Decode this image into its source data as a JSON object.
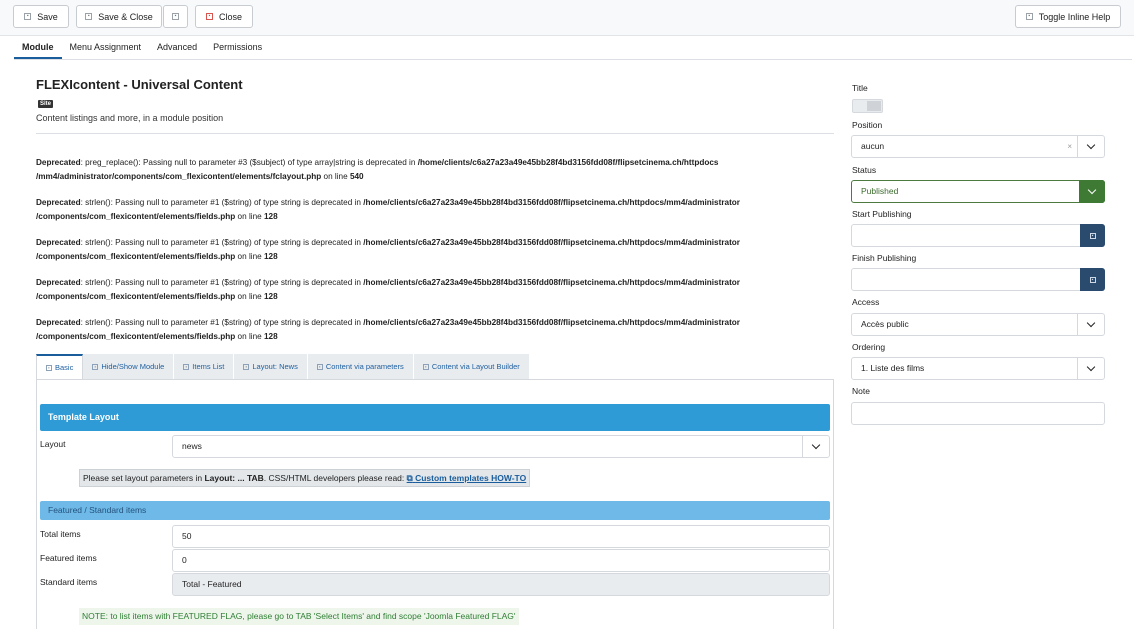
{
  "toolbar": {
    "save": "Save",
    "save_close": "Save & Close",
    "close": "Close",
    "toggle_help": "Toggle Inline Help"
  },
  "tabs": [
    "Module",
    "Menu Assignment",
    "Advanced",
    "Permissions"
  ],
  "module": {
    "title": "FLEXIcontent - Universal Content",
    "badge": "Site",
    "description": "Content listings and more, in a module position"
  },
  "deprecations": [
    {
      "label": "Deprecated",
      "message": ": preg_replace(): Passing null to parameter #3 ($subject) of type array|string is deprecated in ",
      "path1": "/home/clients/c6a27a23a49e45bb28f4bd3156fdd08f/flipsetcinema.ch/httpdocs",
      "path2": "/mm4/administrator/components/com_flexicontent/elements/fclayout.php",
      "online": " on line ",
      "line": "540"
    },
    {
      "label": "Deprecated",
      "message": ": strlen(): Passing null to parameter #1 ($string) of type string is deprecated in ",
      "path1": "/home/clients/c6a27a23a49e45bb28f4bd3156fdd08f/flipsetcinema.ch/httpdocs/mm4/administrator",
      "path2": "/components/com_flexicontent/elements/fields.php",
      "online": " on line ",
      "line": "128"
    },
    {
      "label": "Deprecated",
      "message": ": strlen(): Passing null to parameter #1 ($string) of type string is deprecated in ",
      "path1": "/home/clients/c6a27a23a49e45bb28f4bd3156fdd08f/flipsetcinema.ch/httpdocs/mm4/administrator",
      "path2": "/components/com_flexicontent/elements/fields.php",
      "online": " on line ",
      "line": "128"
    },
    {
      "label": "Deprecated",
      "message": ": strlen(): Passing null to parameter #1 ($string) of type string is deprecated in ",
      "path1": "/home/clients/c6a27a23a49e45bb28f4bd3156fdd08f/flipsetcinema.ch/httpdocs/mm4/administrator",
      "path2": "/components/com_flexicontent/elements/fields.php",
      "online": " on line ",
      "line": "128"
    },
    {
      "label": "Deprecated",
      "message": ": strlen(): Passing null to parameter #1 ($string) of type string is deprecated in ",
      "path1": "/home/clients/c6a27a23a49e45bb28f4bd3156fdd08f/flipsetcinema.ch/httpdocs/mm4/administrator",
      "path2": "/components/com_flexicontent/elements/fields.php",
      "online": " on line ",
      "line": "128"
    }
  ],
  "subtabs": [
    "Basic",
    "Hide/Show Module",
    "Items List",
    "Layout: News",
    "Content via parameters",
    "Content via Layout Builder"
  ],
  "template_layout": {
    "header": "Template Layout",
    "layout_label": "Layout",
    "layout_value": "news",
    "note_prefix": "Please set layout parameters in ",
    "note_bold": "Layout: ... TAB",
    "note_mid": ". CSS/HTML developers please read: ",
    "note_link": "Custom templates HOW-TO"
  },
  "featured": {
    "header": "Featured / Standard items",
    "total_label": "Total items",
    "total_value": "50",
    "featured_label": "Featured items",
    "featured_value": "0",
    "standard_label": "Standard items",
    "standard_value": "Total - Featured",
    "note": "NOTE: to list items with FEATURED FLAG, please go to TAB 'Select Items' and find scope 'Joomla Featured FLAG'"
  },
  "sidebar": {
    "title_label": "Title",
    "position_label": "Position",
    "position_value": "aucun",
    "position_clear": "×",
    "status_label": "Status",
    "status_value": "Published",
    "start_label": "Start Publishing",
    "finish_label": "Finish Publishing",
    "access_label": "Access",
    "access_value": "Accès public",
    "ordering_label": "Ordering",
    "ordering_value": "1. Liste des films",
    "note_label": "Note"
  },
  "colors": {
    "primary": "#1a5d9c",
    "header_blue": "#2e9bd6",
    "light_blue": "#6fb9e8",
    "status_green": "#3f7a35",
    "calendar_dark": "#2a4a6e"
  }
}
